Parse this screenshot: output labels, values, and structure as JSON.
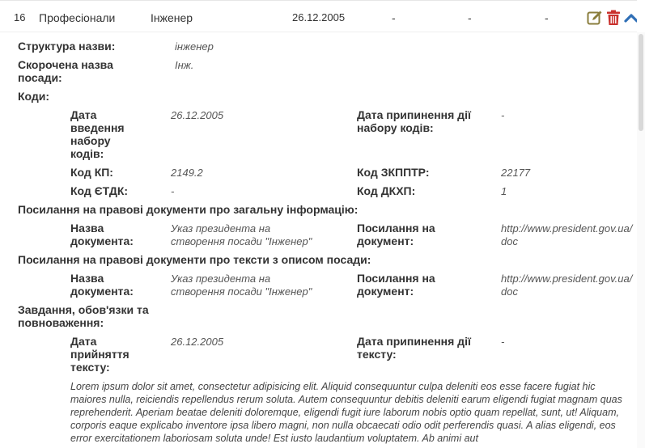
{
  "row": {
    "number": "16",
    "category": "Професіонали",
    "title": "Інженер",
    "date": "26.12.2005",
    "dash1": "-",
    "dash2": "-",
    "dash3": "-"
  },
  "details": {
    "name_structure_label": "Структура назви:",
    "name_structure_value": "інженер",
    "short_name_label_line1": "Скорочена назва",
    "short_name_label_line2": "посади:",
    "short_name_value": "Інж.",
    "codes_label": "Коди:",
    "codes": {
      "intro_date_label": [
        "Дата",
        "введення",
        "набору",
        "кодів:"
      ],
      "intro_date_value": "26.12.2005",
      "end_date_label_line1": "Дата припинення дії",
      "end_date_label_line2": "набору кодів:",
      "end_date_value": "-",
      "kp_label": "Код КП:",
      "kp_value": "2149.2",
      "zkpptr_label": "Код ЗКППТР:",
      "zkpptr_value": "22177",
      "etdk_label": "Код ЄТДК:",
      "etdk_value": "-",
      "dkhp_label": "Код ДКХП:",
      "dkhp_value": "1"
    },
    "legal_general": {
      "heading": "Посилання на правові документи про загальну інформацію:",
      "doc_name_label_line1": "Назва",
      "doc_name_label_line2": "документа:",
      "doc_name_value_line1": "Указ президента на",
      "doc_name_value_line2": "створення посади \"Інженер\"",
      "link_label_line1": "Посилання на",
      "link_label_line2": "документ:",
      "link_value_line1": "http://www.president.gov.ua/",
      "link_value_line2": "doc"
    },
    "legal_texts": {
      "heading": "Посилання на правові документи про тексти з описом посади:",
      "doc_name_label_line1": "Назва",
      "doc_name_label_line2": "документа:",
      "doc_name_value_line1": "Указ президента на",
      "doc_name_value_line2": "створення посади \"Інженер\"",
      "link_label_line1": "Посилання на",
      "link_label_line2": "документ:",
      "link_value_line1": "http://www.president.gov.ua/",
      "link_value_line2": "doc"
    },
    "duties": {
      "heading_line1": "Завдання, обов'язки та",
      "heading_line2": "повноваження:",
      "adopt_date_label": [
        "Дата",
        "прийняття",
        "тексту:"
      ],
      "adopt_date_value": "26.12.2005",
      "end_label_line1": "Дата припинення дії",
      "end_label_line2": "тексту:",
      "end_value": "-",
      "text": "Lorem ipsum dolor sit amet, consectetur adipisicing elit. Aliquid consequuntur culpa deleniti eos esse facere fugiat hic maiores nulla, reiciendis repellendus rerum soluta. Autem consequuntur debitis deleniti earum eligendi fugiat magnam quas reprehenderit. Aperiam beatae deleniti doloremque, eligendi fugit iure laborum nobis optio quam repellat, sunt, ut! Aliquam, corporis eaque explicabo inventore ipsa libero magni, non nulla obcaecati odio odit perferendis quasi. A alias eligendi, eos error exercitationem laboriosam soluta unde! Est iusto laudantium voluptatem. Ab animi aut"
    }
  },
  "icons": {
    "edit": "edit-icon",
    "delete": "trash-icon",
    "collapse": "chevron-up-icon"
  },
  "colors": {
    "edit_icon": "#8a7d3c",
    "delete_icon": "#c9302c",
    "collapse_icon": "#2f6fb6"
  }
}
